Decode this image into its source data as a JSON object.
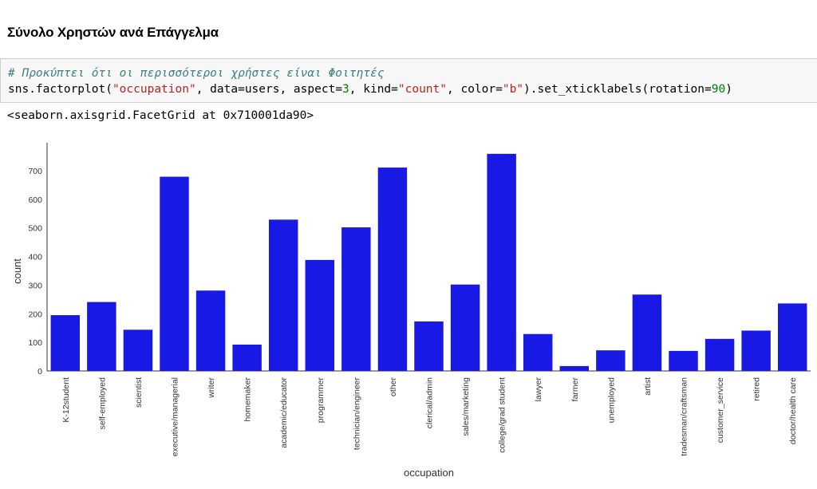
{
  "heading": "Σύνολο Χρηστών ανά Επάγγελμα",
  "code": {
    "comment": "# Προκύπτει ότι οι περισσότεροι χρήστες είναι Φοιτητές",
    "line_pre": "sns.factorplot(",
    "arg1": "\"occupation\"",
    "mid1": ", data=users, aspect=",
    "aspect": "3",
    "mid2": ", kind=",
    "kind": "\"count\"",
    "mid3": ", color=",
    "color_arg": "\"b\"",
    "mid4": ").set_xticklabels(rotation=",
    "rotation": "90",
    "end": ")"
  },
  "output_text": "<seaborn.axisgrid.FacetGrid at 0x710001da90>",
  "chart_data": {
    "type": "bar",
    "xlabel": "occupation",
    "ylabel": "count",
    "ylim": [
      0,
      800
    ],
    "yticks": [
      0,
      100,
      200,
      300,
      400,
      500,
      600,
      700
    ],
    "categories": [
      "K-12student",
      "self-employed",
      "scientist",
      "executive/managerial",
      "writer",
      "homemaker",
      "academic/educator",
      "programmer",
      "technician/engineer",
      "other",
      "clerical/admin",
      "sales/marketing",
      "college/grad student",
      "lawyer",
      "farmer",
      "unemployed",
      "artist",
      "tradesman/craftsman",
      "customer_service",
      "retired",
      "doctor/health care"
    ],
    "values": [
      195,
      241,
      144,
      679,
      281,
      92,
      529,
      388,
      502,
      711,
      173,
      302,
      759,
      129,
      17,
      72,
      267,
      70,
      112,
      141,
      236
    ],
    "bar_color": "#1919e6",
    "grid": false
  }
}
